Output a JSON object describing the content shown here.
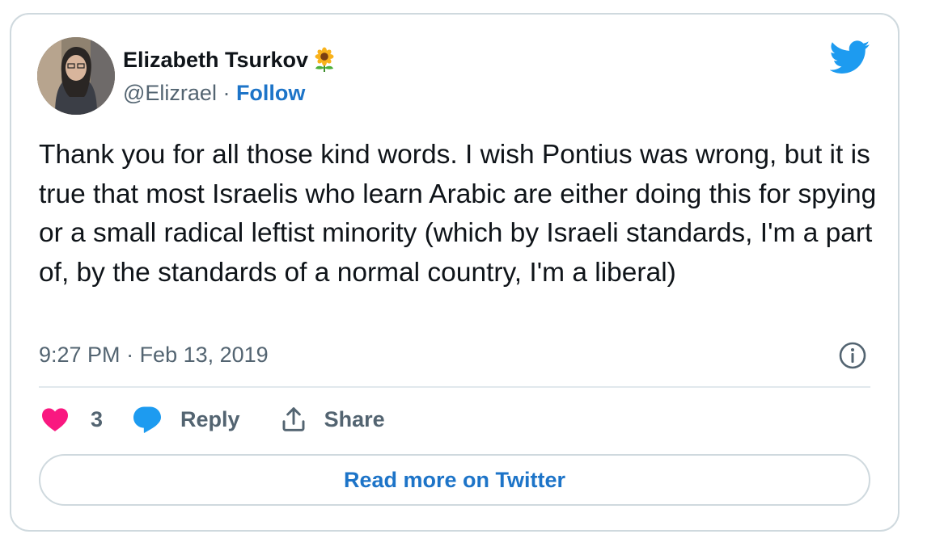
{
  "author": {
    "name": "Elizabeth Tsurkov",
    "name_emoji": "sunflower-icon",
    "handle": "@Elizrael",
    "separator": " · ",
    "follow_label": "Follow"
  },
  "tweet": {
    "text": "Thank you for all those kind words. I wish Pontius was wrong, but it is true that most Israelis who learn Arabic are either doing this for spying or a small radical leftist minority (which by Israeli standards, I'm a part of, by the standards of a normal country, I'm a liberal)",
    "time": "9:27 PM",
    "date_separator": " · ",
    "date": "Feb 13, 2019"
  },
  "actions": {
    "like_count": "3",
    "reply_label": "Reply",
    "share_label": "Share"
  },
  "footer": {
    "read_more_label": "Read more on Twitter"
  },
  "colors": {
    "twitter_blue": "#1d9bf0",
    "link_blue": "#1d74c8",
    "like_pink": "#f91880",
    "muted_text": "#536471",
    "border": "#cfd9de"
  }
}
